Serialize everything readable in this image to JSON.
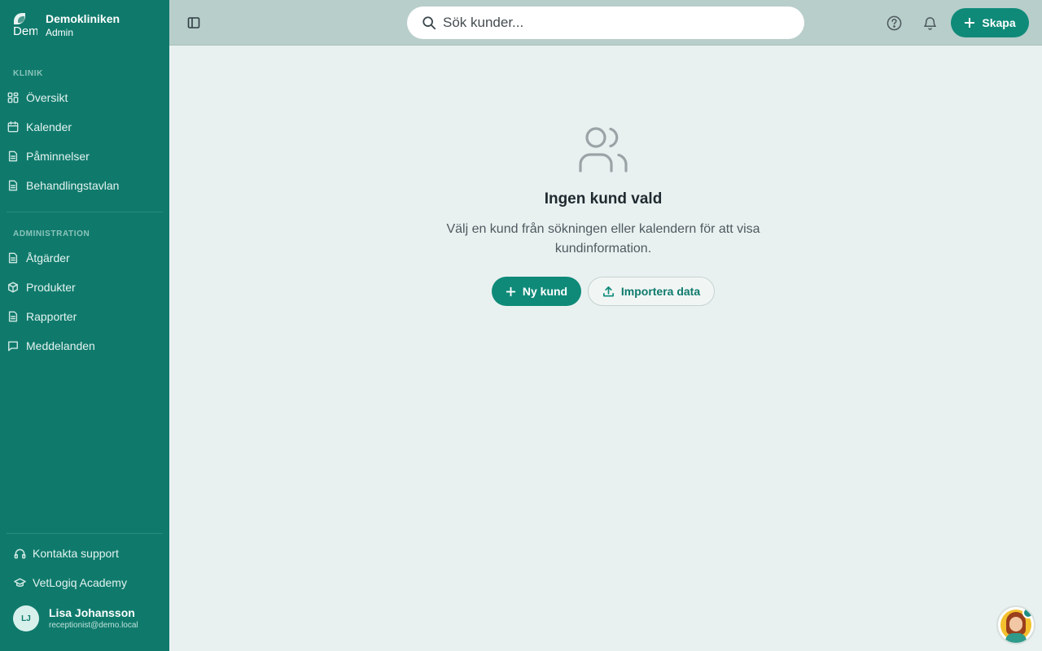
{
  "brand": {
    "logo_text": "Dem",
    "name": "Demokliniken",
    "role": "Admin"
  },
  "sidebar": {
    "section_klinik": "KLINIK",
    "klinik_items": [
      {
        "label": "Översikt",
        "icon": "grid-icon"
      },
      {
        "label": "Kalender",
        "icon": "calendar-icon"
      },
      {
        "label": "Påminnelser",
        "icon": "document-icon"
      },
      {
        "label": "Behandlingstavlan",
        "icon": "document-icon"
      }
    ],
    "section_admin": "ADMINISTRATION",
    "admin_items": [
      {
        "label": "Åtgärder",
        "icon": "document-icon"
      },
      {
        "label": "Produkter",
        "icon": "box-icon"
      },
      {
        "label": "Rapporter",
        "icon": "document-icon"
      },
      {
        "label": "Meddelanden",
        "icon": "message-icon"
      }
    ],
    "footer": {
      "support": "Kontakta support",
      "academy": "VetLogiq Academy"
    },
    "user": {
      "initials": "LJ",
      "name": "Lisa Johansson",
      "email": "receptionist@demo.local"
    }
  },
  "topbar": {
    "search_placeholder": "Sök kunder...",
    "create_label": "Skapa"
  },
  "main": {
    "empty_title": "Ingen kund vald",
    "empty_text": "Välj en kund från sökningen eller kalendern för att visa kundinformation.",
    "new_customer_label": "Ny kund",
    "import_label": "Importera data"
  },
  "colors": {
    "sidebar": "#0f7a6c",
    "accent": "#0f8a79",
    "topbar": "#b8ceca",
    "background": "#e9f1f0"
  }
}
